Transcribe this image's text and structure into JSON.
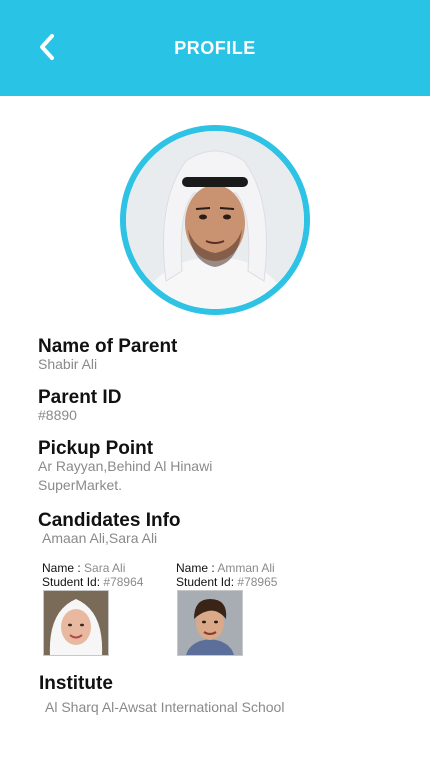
{
  "header": {
    "title": "PROFILE",
    "back_icon": "chevron-left-icon",
    "bg_color": "#29c3e5"
  },
  "avatar": {
    "icon": "parent-photo",
    "ring_color": "#2ec2e4"
  },
  "parent": {
    "name_label": "Name of Parent",
    "name_value": "Shabir Ali",
    "id_label": "Parent ID",
    "id_value": "#8890",
    "pickup_label": "Pickup Point",
    "pickup_value_line1": "Ar Rayyan,Behind Al Hinawi",
    "pickup_value_line2": "SuperMarket."
  },
  "candidates": {
    "label": "Candidates Info",
    "value": "Amaan Ali,Sara Ali",
    "students": [
      {
        "name_key": "Name :",
        "name": "Sara Ali",
        "id_key": "Student Id:",
        "id": "#78964"
      },
      {
        "name_key": "Name :",
        "name": "Amman Ali",
        "id_key": "Student Id:",
        "id": "#78965"
      }
    ]
  },
  "institute": {
    "label": "Institute",
    "value": "Al Sharq Al-Awsat International School"
  }
}
